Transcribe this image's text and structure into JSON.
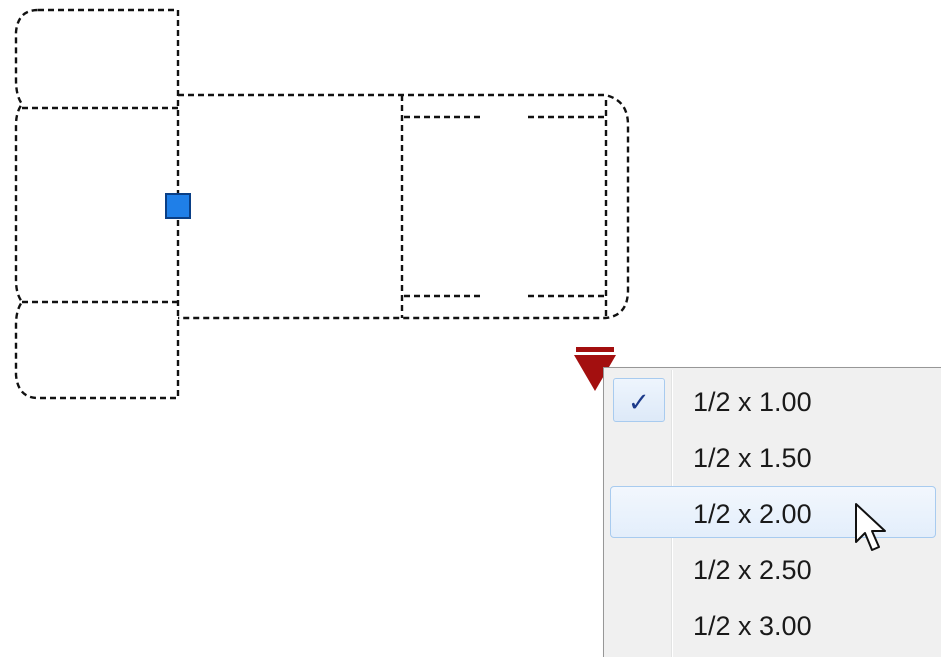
{
  "menu": {
    "items": [
      {
        "label": "1/2 x 1.00",
        "checked": true,
        "hover": false
      },
      {
        "label": "1/2 x 1.50",
        "checked": false,
        "hover": false
      },
      {
        "label": "1/2 x 2.00",
        "checked": false,
        "hover": true
      },
      {
        "label": "1/2 x 2.50",
        "checked": false,
        "hover": false
      },
      {
        "label": "1/2 x 3.00",
        "checked": false,
        "hover": false
      }
    ],
    "check_symbol": "✓"
  },
  "colors": {
    "grip_blue": "#1f7fe8",
    "flyout_grip_red": "#a30f0f",
    "menu_hover_border": "#a8cbef",
    "check_mark": "#1c3a8a"
  },
  "icons": {
    "grip": "square-grip-icon",
    "flyout": "triangle-grip-icon",
    "check": "check-icon",
    "cursor": "arrow-cursor-icon"
  }
}
